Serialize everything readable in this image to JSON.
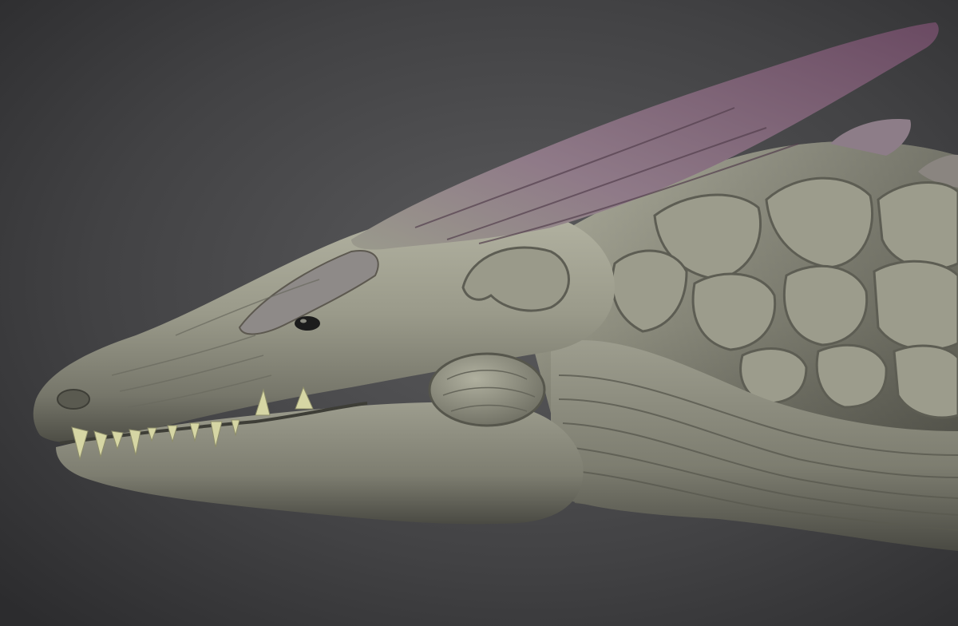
{
  "image": {
    "kind": "3d-sculpt-render",
    "subject": "dragon-head-profile",
    "colors": {
      "background_center": "#5a5a5c",
      "background_edge": "#2e2e30",
      "skin_light": "#a9aa98",
      "skin_mid": "#8c8c7d",
      "skin_shadow": "#55554c",
      "horn_light": "#9a7a90",
      "horn_dark": "#5e4458",
      "teeth": "#d6d6a4",
      "eye": "#1c1c1c"
    }
  }
}
